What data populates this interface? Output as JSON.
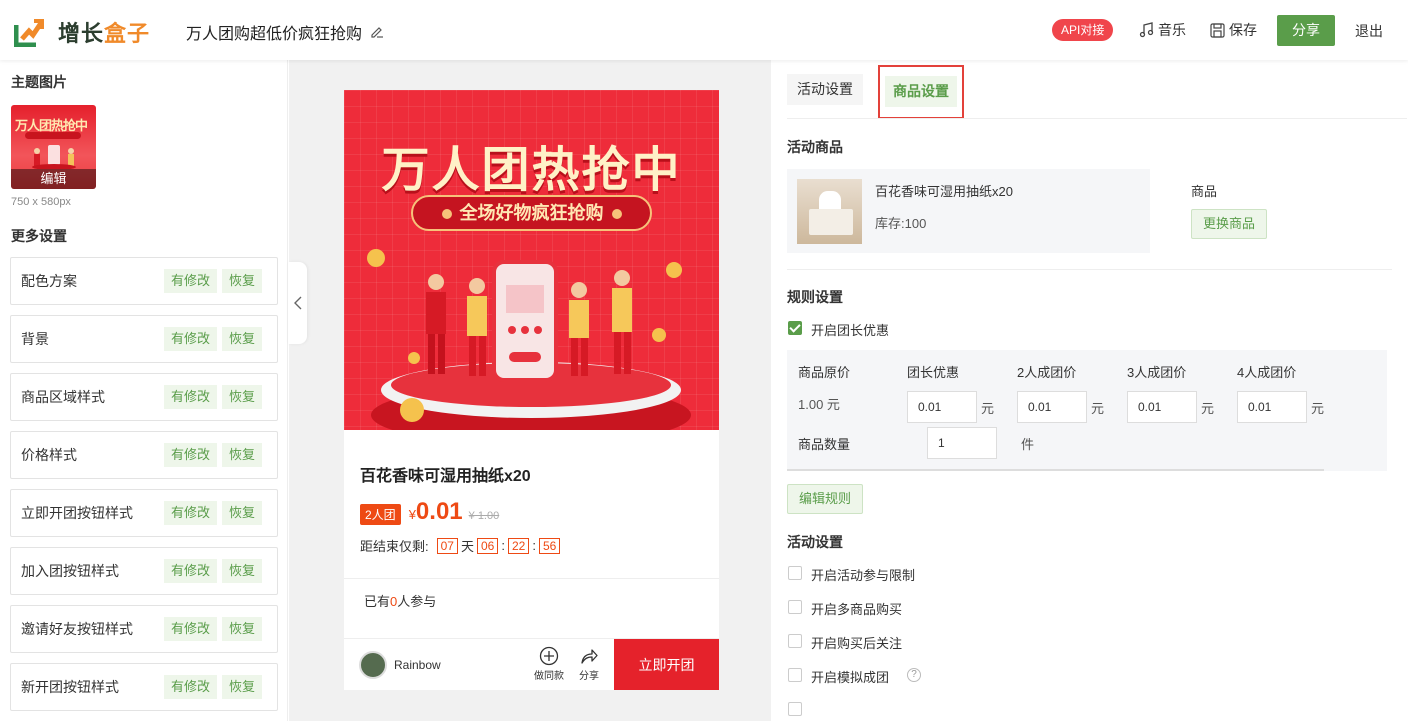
{
  "header": {
    "logo_text_a": "增长",
    "logo_text_b": "盒子",
    "doc_title": "万人团购超低价疯狂抢购",
    "api_badge": "API对接",
    "music": "音乐",
    "save": "保存",
    "share": "分享",
    "logout": "退出"
  },
  "left": {
    "theme_title": "主题图片",
    "theme_edit": "编辑",
    "theme_size": "750 x 580px",
    "more_title": "更多设置",
    "items": [
      {
        "label": "配色方案",
        "modified": "有修改",
        "restore": "恢复"
      },
      {
        "label": "背景",
        "modified": "有修改",
        "restore": "恢复"
      },
      {
        "label": "商品区域样式",
        "modified": "有修改",
        "restore": "恢复"
      },
      {
        "label": "价格样式",
        "modified": "有修改",
        "restore": "恢复"
      },
      {
        "label": "立即开团按钮样式",
        "modified": "有修改",
        "restore": "恢复"
      },
      {
        "label": "加入团按钮样式",
        "modified": "有修改",
        "restore": "恢复"
      },
      {
        "label": "邀请好友按钮样式",
        "modified": "有修改",
        "restore": "恢复"
      },
      {
        "label": "新开团按钮样式",
        "modified": "有修改",
        "restore": "恢复"
      }
    ]
  },
  "preview": {
    "banner_title": "万人团热抢中",
    "banner_sub": "全场好物疯狂抢购",
    "product_name": "百花香味可湿用抽纸x20",
    "team_tag": "2人团",
    "yen": "¥",
    "price": "0.01",
    "orig_price": "¥ 1.00",
    "countdown_label": "距结束仅剩:",
    "cd_days": "07",
    "cd_day_unit": "天",
    "cd_hours": "06",
    "cd_minutes": "22",
    "cd_seconds": "56",
    "colon": ":",
    "joined_prefix": "已有",
    "joined_num": "0",
    "joined_suffix": "人参与",
    "username": "Rainbow",
    "same_style": "做同款",
    "share": "分享",
    "open_group": "立即开团"
  },
  "right": {
    "tabs": [
      "活动设置",
      "商品设置"
    ],
    "activity_goods_title": "活动商品",
    "goods_name": "百花香味可湿用抽纸x20",
    "goods_stock": "库存:100",
    "goods_label": "商品",
    "change_goods": "更换商品",
    "rules_title": "规则设置",
    "leader_discount_label": "开启团长优惠",
    "leader_discount_checked": true,
    "rules": {
      "headers": [
        "商品原价",
        "团长优惠",
        "2人成团价",
        "3人成团价",
        "4人成团价"
      ],
      "orig_price": "1.00 元",
      "values": [
        "0.01",
        "0.01",
        "0.01",
        "0.01"
      ],
      "unit_yuan": "元",
      "qty_label": "商品数量",
      "qty_value": "1",
      "qty_unit": "件"
    },
    "edit_rules": "编辑规则",
    "activity_settings_title": "活动设置",
    "options": [
      "开启活动参与限制",
      "开启多商品购买",
      "开启购买后关注",
      "开启模拟成团"
    ]
  },
  "colors": {
    "brand_green": "#5a9d4a",
    "accent_red": "#e5222b",
    "price_orange": "#ee4a14",
    "logo_orange": "#f08a2a"
  }
}
